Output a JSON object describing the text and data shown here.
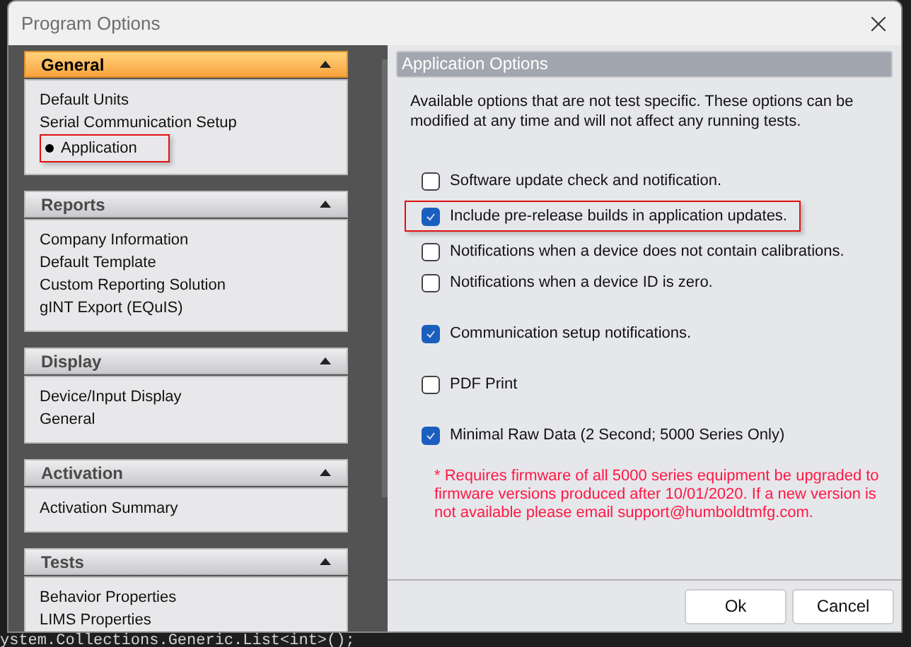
{
  "window": {
    "title": "Program Options"
  },
  "background_code": "ystem.Collections.Generic.List<int>();",
  "sidebar": {
    "groups": [
      {
        "title": "General",
        "selected": true,
        "expanded": true,
        "items": [
          {
            "label": "Default Units",
            "selected": false
          },
          {
            "label": "Serial Communication Setup",
            "selected": false
          },
          {
            "label": "Application",
            "selected": true
          }
        ]
      },
      {
        "title": "Reports",
        "selected": false,
        "expanded": true,
        "items": [
          {
            "label": "Company Information",
            "selected": false
          },
          {
            "label": "Default Template",
            "selected": false
          },
          {
            "label": "Custom Reporting Solution",
            "selected": false
          },
          {
            "label": "gINT Export (EQuIS)",
            "selected": false
          }
        ]
      },
      {
        "title": "Display",
        "selected": false,
        "expanded": true,
        "items": [
          {
            "label": "Device/Input Display",
            "selected": false
          },
          {
            "label": "General",
            "selected": false
          }
        ]
      },
      {
        "title": "Activation",
        "selected": false,
        "expanded": true,
        "items": [
          {
            "label": "Activation Summary",
            "selected": false
          }
        ]
      },
      {
        "title": "Tests",
        "selected": false,
        "expanded": true,
        "items": [
          {
            "label": "Behavior Properties",
            "selected": false
          },
          {
            "label": "LIMS Properties",
            "selected": false
          }
        ]
      }
    ]
  },
  "panel": {
    "title": "Application Options",
    "description": "Available options that are not test specific.  These options can be modified at any time and will not affect any running tests.",
    "option_groups": [
      {
        "options": [
          {
            "label": "Software update check and notification.",
            "checked": false,
            "highlighted": false
          },
          {
            "label": "Include pre-release builds in application updates.",
            "checked": true,
            "highlighted": true
          },
          {
            "label": "Notifications when a device does not contain calibrations.",
            "checked": false,
            "highlighted": false
          },
          {
            "label": "Notifications when a device ID is zero.",
            "checked": false,
            "highlighted": false
          }
        ]
      },
      {
        "options": [
          {
            "label": "Communication setup notifications.",
            "checked": true,
            "highlighted": false
          }
        ]
      },
      {
        "options": [
          {
            "label": "PDF Print",
            "checked": false,
            "highlighted": false
          }
        ]
      },
      {
        "options": [
          {
            "label": "Minimal Raw Data (2 Second; 5000 Series Only)",
            "checked": true,
            "highlighted": false
          }
        ]
      }
    ],
    "note": "* Requires firmware of all 5000 series equipment be upgraded to firmware versions produced after 10/01/2020.  If a new version is not available please email support@humboldtmfg.com."
  },
  "buttons": [
    "Ok",
    "Cancel"
  ]
}
